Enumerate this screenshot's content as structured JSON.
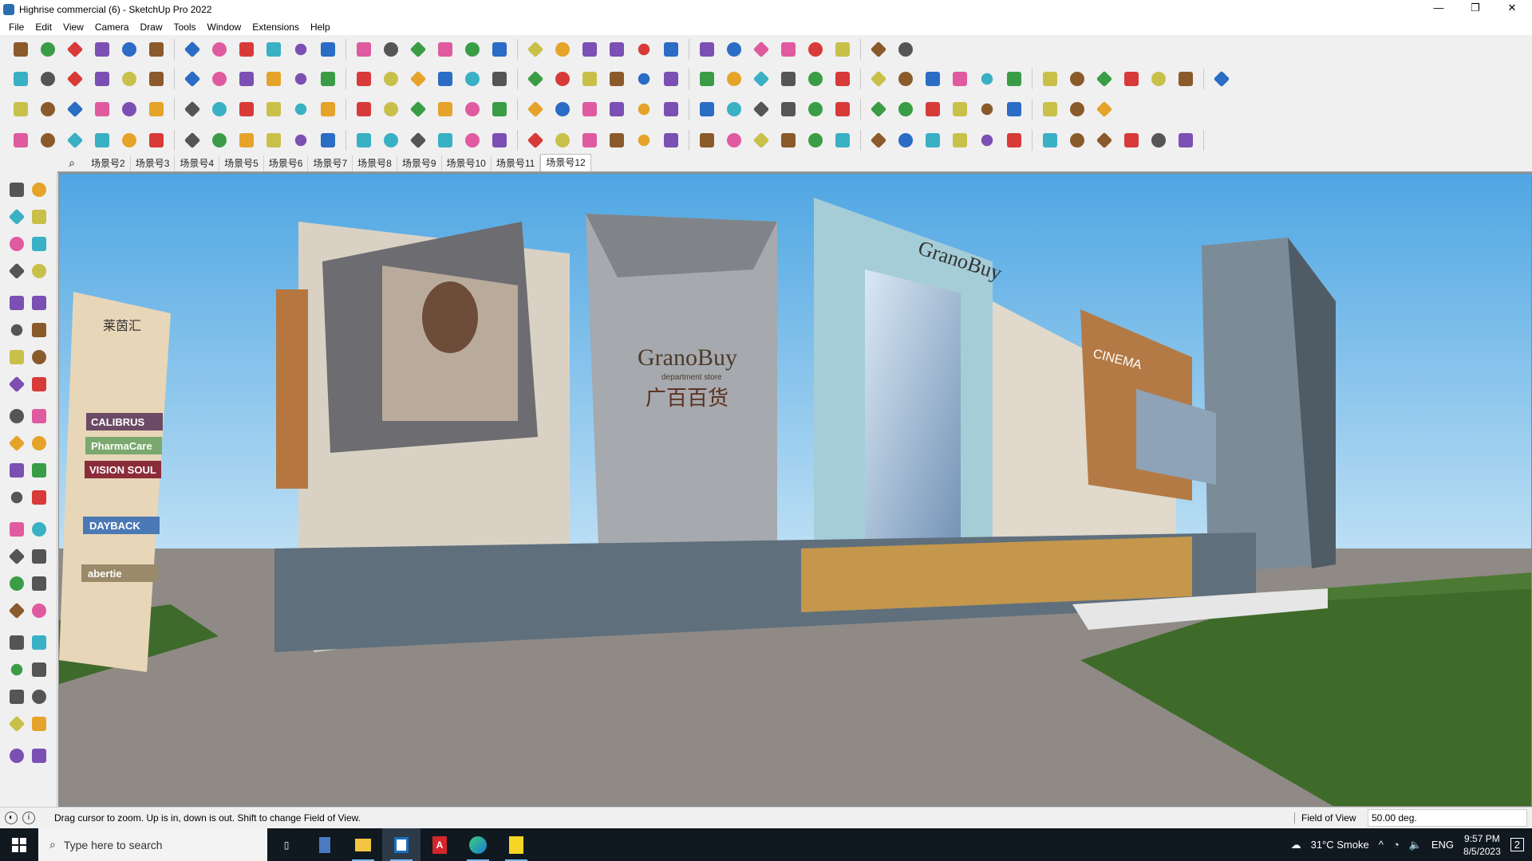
{
  "window": {
    "title": "Highrise commercial (6) - SketchUp Pro 2022",
    "minimize": "—",
    "maximize": "❐",
    "close": "✕"
  },
  "menu": [
    "File",
    "Edit",
    "View",
    "Camera",
    "Draw",
    "Tools",
    "Window",
    "Extensions",
    "Help"
  ],
  "toolbars": {
    "row1": [
      "zoom",
      "select",
      "eraser",
      "line",
      "arc",
      "rectangle",
      "push-pull",
      "follow-me",
      "move",
      "rotate",
      "scale",
      "tape",
      "text",
      "paint",
      "orbit",
      "pan",
      "zoom-window",
      "zoom-extents",
      "outer-shell",
      "intersect",
      "union",
      "subtract",
      "styles",
      "components",
      "section",
      "import",
      "export",
      "dimension",
      "xray",
      "undo",
      "redo",
      "warehouse"
    ],
    "row2": [
      "box-style",
      "wireframe",
      "shaded",
      "push",
      "extrude-1",
      "extrude-2",
      "extrude-3",
      "extrude-4",
      "extrude-5",
      "extrude-6",
      "curve",
      "flip-1",
      "flip-2",
      "flip-3",
      "face",
      "offset",
      "house-1",
      "house-2",
      "house-3",
      "house-4",
      "house-5",
      "house-6",
      "formula",
      "soap",
      "knife",
      "shape-1",
      "shape-2",
      "shape-3",
      "shape-4",
      "shape-5",
      "shape-6",
      "shape-7",
      "shape-8",
      "shape-9",
      "pencil-tool",
      "eraser-2",
      "stamp",
      "brick",
      "solid-1",
      "solid-2",
      "solid-3",
      "solid-4",
      "solid-5"
    ],
    "row3": [
      "plane-1",
      "plane-2",
      "plane-3",
      "plane-4",
      "plane-5",
      "plane-6",
      "loop",
      "square-red",
      "list",
      "flag",
      "cube-wood",
      "chain",
      "corner",
      "bezier",
      "cross",
      "cross-2",
      "x-tool",
      "cone",
      "cone-2",
      "triangle",
      "spiral-1",
      "spiral-2",
      "spiral-3",
      "star",
      "box",
      "hook",
      "tree",
      "clone-1",
      "clone-2",
      "clone-3",
      "gem",
      "grid-1",
      "grid-2",
      "grid-3",
      "grid-4",
      "grid-5",
      "dot-x",
      "arc-2",
      "layout"
    ],
    "row4": [
      "polyline",
      "curve-2",
      "spray",
      "scissors",
      "gear",
      "cloud",
      "pipe",
      "knot",
      "sphere",
      "fold",
      "stair",
      "rail",
      "fence",
      "corner-2",
      "corner-3",
      "beam",
      "pipe-2",
      "column",
      "dome",
      "wall",
      "stairs-2",
      "pyramid",
      "stairs-3",
      "skew",
      "beam-2",
      "fan",
      "truss",
      "track",
      "cabinet",
      "louvre",
      "roof",
      "ramp",
      "steps",
      "grille",
      "shutter",
      "blind",
      "pillars",
      "fan-2",
      "sphere-2",
      "stair-4",
      "tree-2",
      "pavilion"
    ]
  },
  "scenes": {
    "search_icon": "search-icon",
    "tabs": [
      "场景号2",
      "场景号3",
      "场景号4",
      "场景号5",
      "场景号6",
      "场景号7",
      "场景号8",
      "场景号9",
      "场景号10",
      "场景号11",
      "场景号12"
    ],
    "active": "场景号12"
  },
  "left_toolbar": [
    "select",
    "orbit",
    "paint",
    "eraser",
    "components",
    "tape",
    "line",
    "freehand",
    "rectangle",
    "rotated-rect",
    "circle",
    "polygon",
    "arc",
    "pie",
    "arc-3pt",
    "arc-2",
    "move",
    "push-pull",
    "rotate",
    "follow-me",
    "scale",
    "offset",
    "tape-measure",
    "dimension",
    "protractor",
    "text",
    "axes",
    "3d-text",
    "orbit-2",
    "pan",
    "zoom",
    "zoom-window",
    "zoom-extents",
    "previous",
    "position-camera",
    "look-around",
    "walk",
    "section",
    "outer-shell",
    "intersect",
    "union",
    "subtract"
  ],
  "viewport": {
    "signs": {
      "mall_logo": "GranoBuy",
      "mall_sub": "department store",
      "mall_cn": "广百百货",
      "cinema": "CINEMA",
      "pylon_top": "莱茵汇",
      "pylon_brands": [
        "CALIBRUS",
        "PharmaCare",
        "VISION SOUL",
        "DAYBACK",
        "abertie"
      ]
    },
    "colors": {
      "sky_top": "#5aaee6",
      "sky_bottom": "#b6dcf3",
      "ground": "#8f8a86",
      "grass": "#3f6b2a"
    }
  },
  "status": {
    "message": "Drag cursor to zoom.  Up is in, down is out. Shift to change Field of View.",
    "fov_label": "Field of View",
    "fov_value": "50.00 deg."
  },
  "taskbar": {
    "search_placeholder": "Type here to search",
    "apps": [
      "task-view",
      "calculator",
      "file-explorer",
      "sketchup",
      "acrobat",
      "edge",
      "sticky-notes"
    ],
    "weather": "31°C  Smoke",
    "lang": "ENG",
    "time": "9:57 PM",
    "date": "8/5/2023",
    "notifications": "2"
  }
}
